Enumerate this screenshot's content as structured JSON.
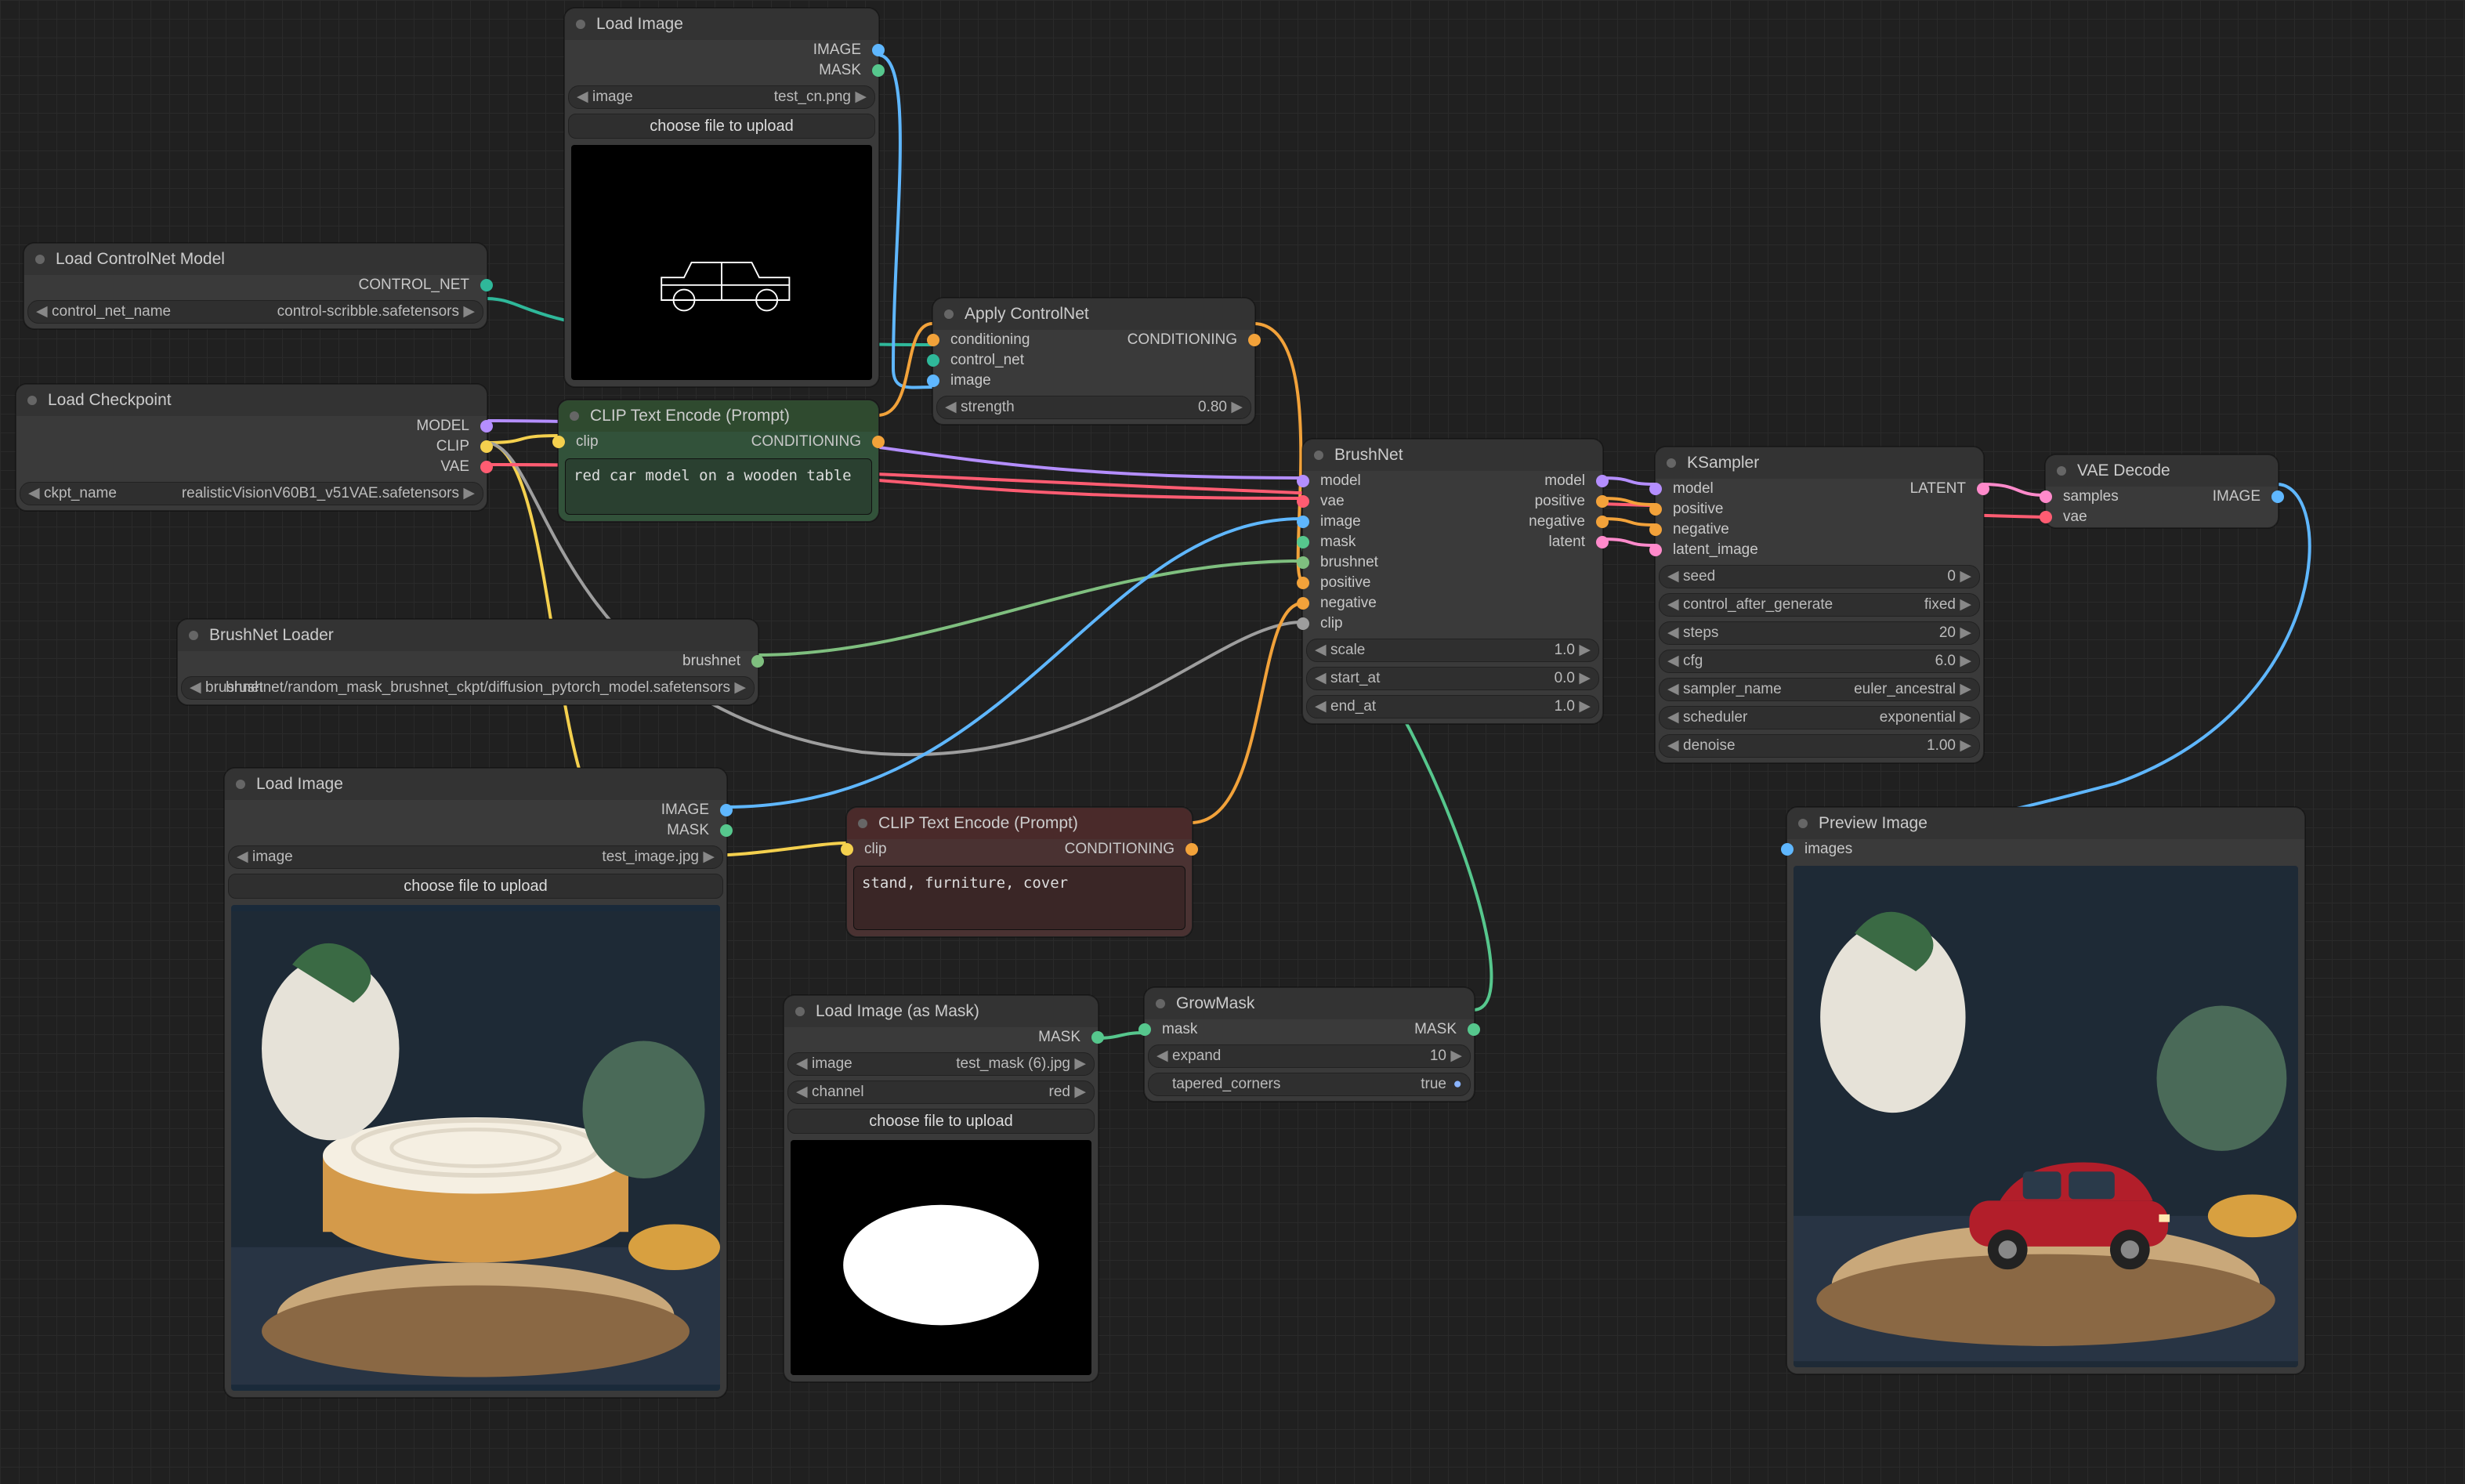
{
  "colors": {
    "image": "#5fb7ff",
    "mask": "#56c78d",
    "conditioning": "#f2a23a",
    "control_net": "#2fb89a",
    "model": "#b48eff",
    "clip": "#f4d04e",
    "vae": "#ff5c72",
    "latent": "#ff8acb",
    "positive": "#f2a23a",
    "negative": "#f2a23a",
    "brushnet": "#7fbf7f",
    "grey": "#9e9e9e"
  },
  "nodes": {
    "load_cn_model": {
      "title": "Load ControlNet Model",
      "out": {
        "control_net": "CONTROL_NET"
      },
      "widget": {
        "label": "control_net_name",
        "value": "control-scribble.safetensors"
      }
    },
    "load_img_cn": {
      "title": "Load Image",
      "out": {
        "image": "IMAGE",
        "mask": "MASK"
      },
      "widget": {
        "label": "image",
        "value": "test_cn.png"
      },
      "btn": "choose file to upload"
    },
    "load_ckpt": {
      "title": "Load Checkpoint",
      "out": {
        "model": "MODEL",
        "clip": "CLIP",
        "vae": "VAE"
      },
      "widget": {
        "label": "ckpt_name",
        "value": "realisticVisionV60B1_v51VAE.safetensors"
      }
    },
    "clip_pos": {
      "title": "CLIP Text Encode (Prompt)",
      "in": {
        "clip": "clip"
      },
      "out": {
        "cond": "CONDITIONING"
      },
      "text": "red car model on a wooden table"
    },
    "clip_neg": {
      "title": "CLIP Text Encode (Prompt)",
      "in": {
        "clip": "clip"
      },
      "out": {
        "cond": "CONDITIONING"
      },
      "text": "stand, furniture, cover"
    },
    "apply_cn": {
      "title": "Apply ControlNet",
      "in": [
        "conditioning",
        "control_net",
        "image"
      ],
      "out": {
        "cond": "CONDITIONING"
      },
      "widget": {
        "label": "strength",
        "value": "0.80"
      }
    },
    "brushnet_loader": {
      "title": "BrushNet Loader",
      "out": {
        "brushnet": "brushnet"
      },
      "widget": {
        "label": "brushnet",
        "value": "brushnet/random_mask_brushnet_ckpt/diffusion_pytorch_model.safetensors"
      }
    },
    "load_img_main": {
      "title": "Load Image",
      "out": {
        "image": "IMAGE",
        "mask": "MASK"
      },
      "widget": {
        "label": "image",
        "value": "test_image.jpg"
      },
      "btn": "choose file to upload"
    },
    "load_mask": {
      "title": "Load Image (as Mask)",
      "out": {
        "mask": "MASK"
      },
      "widget1": {
        "label": "image",
        "value": "test_mask (6).jpg"
      },
      "widget2": {
        "label": "channel",
        "value": "red"
      },
      "btn": "choose file to upload"
    },
    "grow_mask": {
      "title": "GrowMask",
      "in": {
        "mask": "mask"
      },
      "out": {
        "mask": "MASK"
      },
      "w1": {
        "label": "expand",
        "value": "10"
      },
      "w2": {
        "label": "tapered_corners",
        "value": "true"
      }
    },
    "brushnet": {
      "title": "BrushNet",
      "in": [
        "model",
        "vae",
        "image",
        "mask",
        "brushnet",
        "positive",
        "negative",
        "clip"
      ],
      "out": [
        "model",
        "positive",
        "negative",
        "latent"
      ],
      "w1": {
        "label": "scale",
        "value": "1.0"
      },
      "w2": {
        "label": "start_at",
        "value": "0.0"
      },
      "w3": {
        "label": "end_at",
        "value": "1.0"
      }
    },
    "ksampler": {
      "title": "KSampler",
      "in": [
        "model",
        "positive",
        "negative",
        "latent_image"
      ],
      "out": {
        "latent": "LATENT"
      },
      "w": [
        {
          "label": "seed",
          "value": "0"
        },
        {
          "label": "control_after_generate",
          "value": "fixed"
        },
        {
          "label": "steps",
          "value": "20"
        },
        {
          "label": "cfg",
          "value": "6.0"
        },
        {
          "label": "sampler_name",
          "value": "euler_ancestral"
        },
        {
          "label": "scheduler",
          "value": "exponential"
        },
        {
          "label": "denoise",
          "value": "1.00"
        }
      ]
    },
    "vae_decode": {
      "title": "VAE Decode",
      "in": [
        "samples",
        "vae"
      ],
      "out": {
        "image": "IMAGE"
      }
    },
    "preview": {
      "title": "Preview Image",
      "in": {
        "images": "images"
      }
    }
  }
}
